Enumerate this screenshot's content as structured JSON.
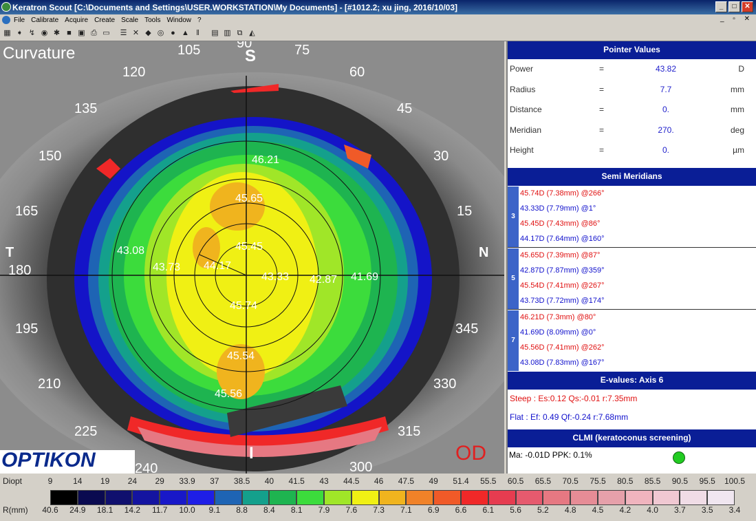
{
  "window": {
    "title": "Keratron Scout [C:\\Documents and Settings\\USER.WORKSTATION\\My Documents] - [#1012.2; xu jing, 2016/10/03]",
    "min": "_",
    "max": "□",
    "close": "✕"
  },
  "menu": [
    "File",
    "Calibrate",
    "Acquire",
    "Create",
    "Scale",
    "Tools",
    "Window",
    "?"
  ],
  "mdi_controls": "_ ▫ ✕",
  "map": {
    "title": "Curvature",
    "eye": "OD",
    "logo": "OPTIKON",
    "superior": "S",
    "inferior": "I",
    "temporal": "T",
    "nasal": "N",
    "angle_labels": [
      "90",
      "105",
      "120",
      "135",
      "150",
      "165",
      "180",
      "195",
      "210",
      "225",
      "240",
      "300",
      "315",
      "330",
      "345",
      "15",
      "30",
      "45",
      "60",
      "75"
    ],
    "radial_values": [
      "46.21",
      "45.65",
      "45.45",
      "43.08",
      "43.73",
      "44.17",
      "43.33",
      "42.87",
      "41.69",
      "45.74",
      "45.54",
      "45.56"
    ]
  },
  "pointer_values": {
    "header": "Pointer Values",
    "rows": [
      {
        "label": "Power",
        "eq": "=",
        "value": "43.82",
        "unit": "D"
      },
      {
        "label": "Radius",
        "eq": "=",
        "value": "7.7",
        "unit": "mm"
      },
      {
        "label": "Distance",
        "eq": "=",
        "value": "0.",
        "unit": "mm"
      },
      {
        "label": "Meridian",
        "eq": "=",
        "value": "270.",
        "unit": "deg"
      },
      {
        "label": "Height",
        "eq": "=",
        "value": "0.",
        "unit": "µm"
      }
    ]
  },
  "semi_meridians": {
    "header": "Semi Meridians",
    "groups": [
      {
        "ring": "3",
        "rows": [
          "45.74D (7.38mm) @266°",
          "43.33D (7.79mm) @1°",
          "45.45D (7.43mm) @86°",
          "44.17D (7.64mm) @160°"
        ]
      },
      {
        "ring": "5",
        "rows": [
          "45.65D (7.39mm) @87°",
          "42.87D (7.87mm) @359°",
          "45.54D (7.41mm) @267°",
          "43.73D (7.72mm) @174°"
        ]
      },
      {
        "ring": "7",
        "rows": [
          "46.21D (7.3mm) @80°",
          "41.69D (8.09mm) @0°",
          "45.56D (7.41mm) @262°",
          "43.08D (7.83mm) @167°"
        ]
      }
    ]
  },
  "evalues": {
    "header": "E-values: Axis 6",
    "steep": "Steep :  Es:0.12 Qs:-0.01 r:7.35mm",
    "flat": "Flat    :  Ef: 0.49 Qf:-0.24 r:7.68mm"
  },
  "clmi": {
    "header": "CLMI (keratoconus screening)",
    "line": "Ma: -0.01D   PPK: 0.1%",
    "indicator_color": "#22cc22"
  },
  "scale": {
    "diopt_label": "Diopt",
    "r_label": "R(mm)",
    "diopt": [
      "9",
      "14",
      "19",
      "24",
      "29",
      "33.9",
      "37",
      "38.5",
      "40",
      "41.5",
      "43",
      "44.5",
      "46",
      "47.5",
      "49",
      "51.4",
      "55.5",
      "60.5",
      "65.5",
      "70.5",
      "75.5",
      "80.5",
      "85.5",
      "90.5",
      "95.5",
      "100.5"
    ],
    "rmm": [
      "40.6",
      "24.9",
      "18.1",
      "14.2",
      "11.7",
      "10.0",
      "9.1",
      "8.8",
      "8.4",
      "8.1",
      "7.9",
      "7.6",
      "7.3",
      "7.1",
      "6.9",
      "6.6",
      "6.1",
      "5.6",
      "5.2",
      "4.8",
      "4.5",
      "4.2",
      "4.0",
      "3.7",
      "3.5",
      "3.4"
    ],
    "colors": [
      "#000000",
      "#0a0a50",
      "#10106e",
      "#1414a0",
      "#1818c8",
      "#1e1ee6",
      "#1e64b4",
      "#14a08c",
      "#1eb450",
      "#3cdc3c",
      "#a0e628",
      "#f0f014",
      "#f0b41e",
      "#f08228",
      "#f05a28",
      "#f02828",
      "#e63c50",
      "#e65a6e",
      "#e67882",
      "#e68c96",
      "#e6a0aa",
      "#f0b4be",
      "#f0c8d2",
      "#f0dce6",
      "#f0e6f0"
    ]
  }
}
